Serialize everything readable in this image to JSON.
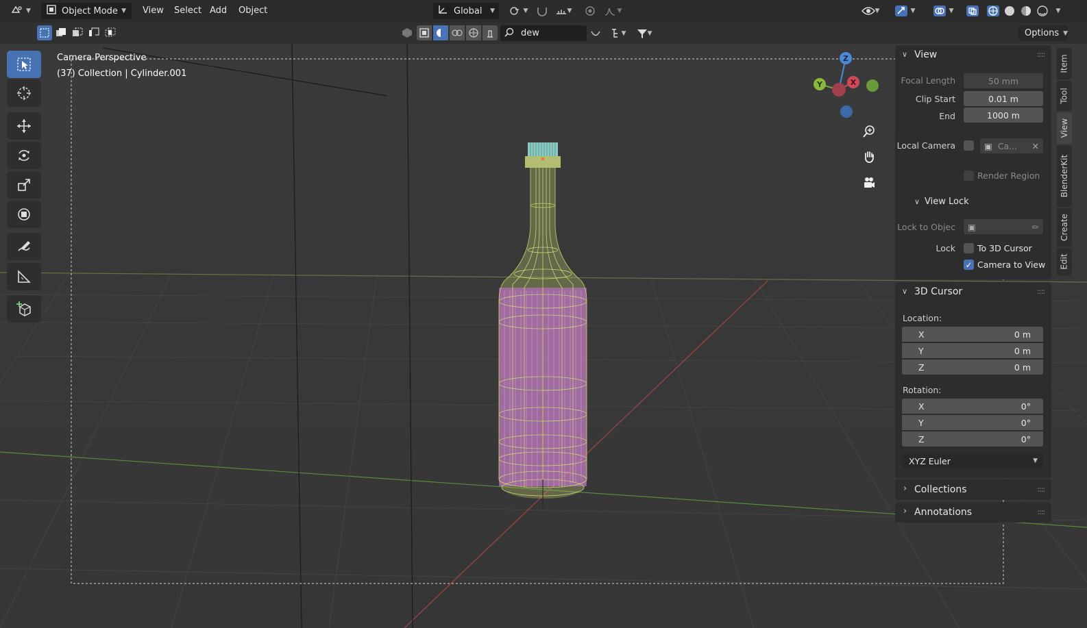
{
  "header": {
    "mode": "Object Mode",
    "menus": [
      "View",
      "Select",
      "Add",
      "Object"
    ],
    "orientation": "Global",
    "options_label": "Options",
    "search_value": "dew"
  },
  "viewport": {
    "camera_label": "Camera Perspective",
    "collection_label": "(37) Collection | Cylinder.001",
    "gizmo": {
      "z": "Z",
      "y": "Y",
      "x": "X"
    }
  },
  "npanel": {
    "view": {
      "title": "View",
      "focal_length_label": "Focal Length",
      "focal_length_value": "50 mm",
      "clip_start_label": "Clip Start",
      "clip_start_value": "0.01 m",
      "end_label": "End",
      "end_value": "1000 m",
      "local_camera_label": "Local Camera",
      "local_camera_value": "Ca...",
      "render_region_label": "Render Region",
      "view_lock_title": "View Lock",
      "lock_to_object_label": "Lock to Objec",
      "lock_label": "Lock",
      "to_3d_cursor_label": "To 3D Cursor",
      "camera_to_view_label": "Camera to View",
      "camera_to_view_checked": true
    },
    "cursor": {
      "title": "3D Cursor",
      "location_label": "Location:",
      "location": [
        {
          "axis": "X",
          "value": "0 m"
        },
        {
          "axis": "Y",
          "value": "0 m"
        },
        {
          "axis": "Z",
          "value": "0 m"
        }
      ],
      "rotation_label": "Rotation:",
      "rotation": [
        {
          "axis": "X",
          "value": "0°"
        },
        {
          "axis": "Y",
          "value": "0°"
        },
        {
          "axis": "Z",
          "value": "0°"
        }
      ],
      "rotation_mode": "XYZ Euler"
    },
    "collections_title": "Collections",
    "annotations_title": "Annotations"
  },
  "sidetabs": [
    "Item",
    "Tool",
    "View",
    "BlenderKit",
    "Create",
    "Edit"
  ]
}
